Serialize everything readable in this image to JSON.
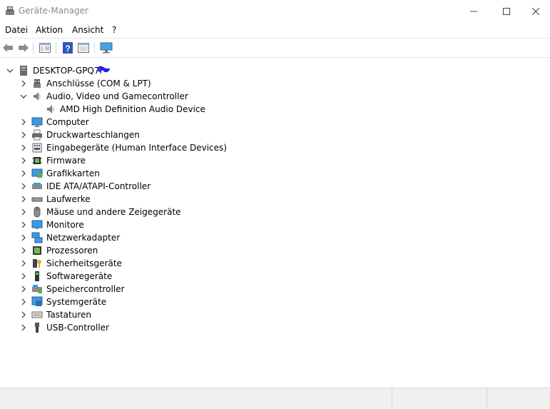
{
  "window": {
    "title": "Geräte-Manager"
  },
  "menu": [
    "Datei",
    "Aktion",
    "Ansicht",
    "?"
  ],
  "toolbar": {
    "buttons": [
      "back-arrow-icon",
      "forward-arrow-icon",
      "properties-pane-icon",
      "help-icon",
      "show-hidden-icon",
      "monitor-scan-icon"
    ]
  },
  "tree": {
    "root": {
      "label": "DESKTOP-GPQ7F",
      "expanded": true
    },
    "categories": [
      {
        "label": "Anschlüsse (COM & LPT)",
        "icon": "port-icon",
        "expanded": false
      },
      {
        "label": "Audio, Video und Gamecontroller",
        "icon": "speaker-icon",
        "expanded": true,
        "children": [
          {
            "label": "AMD High Definition Audio Device",
            "icon": "speaker-icon"
          }
        ]
      },
      {
        "label": "Computer",
        "icon": "computer-icon",
        "expanded": false
      },
      {
        "label": "Druckwarteschlangen",
        "icon": "printer-icon",
        "expanded": false
      },
      {
        "label": "Eingabegeräte (Human Interface Devices)",
        "icon": "hid-icon",
        "expanded": false
      },
      {
        "label": "Firmware",
        "icon": "firmware-chip-icon",
        "expanded": false
      },
      {
        "label": "Grafikkarten",
        "icon": "display-adapter-icon",
        "expanded": false
      },
      {
        "label": "IDE ATA/ATAPI-Controller",
        "icon": "ide-controller-icon",
        "expanded": false
      },
      {
        "label": "Laufwerke",
        "icon": "disk-drive-icon",
        "expanded": false
      },
      {
        "label": "Mäuse und andere Zeigegeräte",
        "icon": "mouse-icon",
        "expanded": false
      },
      {
        "label": "Monitore",
        "icon": "monitor-icon",
        "expanded": false
      },
      {
        "label": "Netzwerkadapter",
        "icon": "network-adapter-icon",
        "expanded": false
      },
      {
        "label": "Prozessoren",
        "icon": "processor-icon",
        "expanded": false
      },
      {
        "label": "Sicherheitsgeräte",
        "icon": "security-device-icon",
        "expanded": false
      },
      {
        "label": "Softwaregeräte",
        "icon": "software-device-icon",
        "expanded": false
      },
      {
        "label": "Speichercontroller",
        "icon": "storage-controller-icon",
        "expanded": false
      },
      {
        "label": "Systemgeräte",
        "icon": "system-device-icon",
        "expanded": false
      },
      {
        "label": "Tastaturen",
        "icon": "keyboard-icon",
        "expanded": false
      },
      {
        "label": "USB-Controller",
        "icon": "usb-icon",
        "expanded": false
      }
    ]
  },
  "colors": {
    "accent": "#0078d7",
    "title_text": "#8a8a8a",
    "scribble": "#1a1aff"
  }
}
